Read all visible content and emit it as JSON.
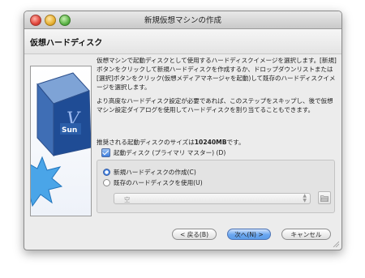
{
  "window": {
    "title": "新規仮想マシンの作成"
  },
  "page": {
    "title": "仮想ハードディスク"
  },
  "content": {
    "paragraph1": "仮想マシンで起動ディスクとして使用するハードディスクイメージを選択します。[新規]ボタンをクリックして新規ハードディスクを作成するか、ドロップダウンリストまたは[選択]ボタンをクリック(仮想メディアマネージャを起動)して既存のハードディスクイメージを選択します。",
    "paragraph2": "より高度なハードディスク設定が必要であれば、このステップをスキップし、後で仮想マシン設定ダイアログを使用してハードディスクを割り当てることもできます。",
    "size_prefix": "推奨される起動ディスクのサイズは",
    "size_value": "10240",
    "size_unit": "MB",
    "size_suffix": "です。"
  },
  "boot_disk": {
    "label": "起動ディスク (プライマリ マスター) (D)",
    "checked": true
  },
  "options": {
    "create_new": {
      "label": "新規ハードディスクの作成(C)",
      "selected": true
    },
    "use_existing": {
      "label": "既存のハードディスクを使用(U)",
      "selected": false
    },
    "existing_combo_value": "空"
  },
  "buttons": {
    "back": "< 戻る(B)",
    "next": "次へ(N) >",
    "cancel": "キャンセル"
  },
  "icons": {
    "folder": "folder-open-icon",
    "logo": "virtualbox-sun-logo"
  },
  "colors": {
    "accent": "#3c7ee0",
    "default_button": "#6aa6f0"
  }
}
